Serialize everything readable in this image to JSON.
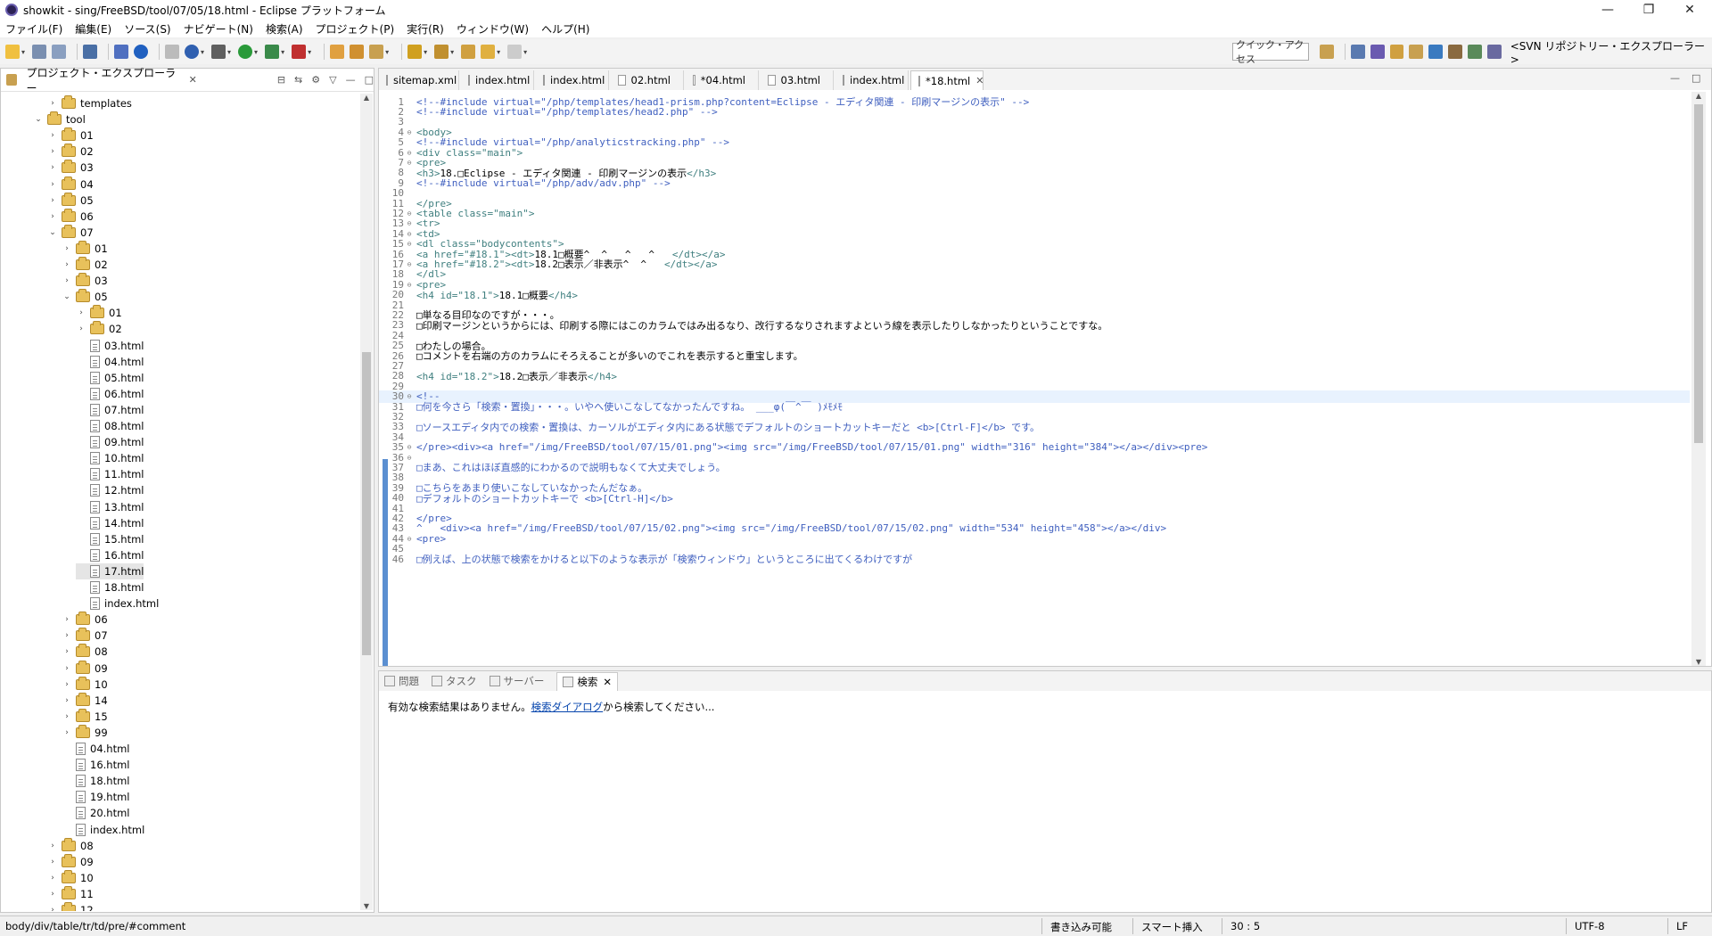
{
  "window": {
    "title": "showkit - sing/FreeBSD/tool/07/05/18.html - Eclipse プラットフォーム",
    "minimize": "—",
    "maximize": "❐",
    "close": "✕"
  },
  "menu": [
    "ファイル(F)",
    "編集(E)",
    "ソース(S)",
    "ナビゲート(N)",
    "検索(A)",
    "プロジェクト(P)",
    "実行(R)",
    "ウィンドウ(W)",
    "ヘルプ(H)"
  ],
  "toolbar": {
    "quick_access": "クイック・アクセス",
    "perspective": "<SVN リポジトリー・エクスプローラー>"
  },
  "explorer": {
    "title": "プロジェクト・エクスプローラー",
    "close": "✕",
    "tree": [
      {
        "label": "templates",
        "type": "folder",
        "level": 2,
        "twisty": "›"
      },
      {
        "label": "tool",
        "type": "project",
        "level": 1,
        "twisty": "⌄"
      },
      {
        "label": "01",
        "type": "folder",
        "level": 2,
        "twisty": "›"
      },
      {
        "label": "02",
        "type": "folder",
        "level": 2,
        "twisty": "›"
      },
      {
        "label": "03",
        "type": "folder",
        "level": 2,
        "twisty": "›"
      },
      {
        "label": "04",
        "type": "folder",
        "level": 2,
        "twisty": "›"
      },
      {
        "label": "05",
        "type": "folder",
        "level": 2,
        "twisty": "›"
      },
      {
        "label": "06",
        "type": "folder",
        "level": 2,
        "twisty": "›"
      },
      {
        "label": "07",
        "type": "folder",
        "level": 2,
        "twisty": "⌄"
      },
      {
        "label": "01",
        "type": "folder",
        "level": 3,
        "twisty": "›"
      },
      {
        "label": "02",
        "type": "folder",
        "level": 3,
        "twisty": "›"
      },
      {
        "label": "03",
        "type": "folder",
        "level": 3,
        "twisty": "›"
      },
      {
        "label": "05",
        "type": "folder",
        "level": 3,
        "twisty": "⌄"
      },
      {
        "label": "01",
        "type": "folder",
        "level": 4,
        "twisty": "›"
      },
      {
        "label": "02",
        "type": "folder",
        "level": 4,
        "twisty": "›"
      },
      {
        "label": "03.html",
        "type": "file",
        "level": 4
      },
      {
        "label": "04.html",
        "type": "file",
        "level": 4
      },
      {
        "label": "05.html",
        "type": "file",
        "level": 4
      },
      {
        "label": "06.html",
        "type": "file",
        "level": 4
      },
      {
        "label": "07.html",
        "type": "file",
        "level": 4
      },
      {
        "label": "08.html",
        "type": "file",
        "level": 4
      },
      {
        "label": "09.html",
        "type": "file",
        "level": 4
      },
      {
        "label": "10.html",
        "type": "file",
        "level": 4
      },
      {
        "label": "11.html",
        "type": "file",
        "level": 4
      },
      {
        "label": "12.html",
        "type": "file",
        "level": 4
      },
      {
        "label": "13.html",
        "type": "file",
        "level": 4
      },
      {
        "label": "14.html",
        "type": "file",
        "level": 4
      },
      {
        "label": "15.html",
        "type": "file",
        "level": 4
      },
      {
        "label": "16.html",
        "type": "file",
        "level": 4
      },
      {
        "label": "17.html",
        "type": "file",
        "level": 4,
        "selected": true
      },
      {
        "label": "18.html",
        "type": "file",
        "level": 4
      },
      {
        "label": "index.html",
        "type": "file",
        "level": 4
      },
      {
        "label": "06",
        "type": "folder",
        "level": 3,
        "twisty": "›"
      },
      {
        "label": "07",
        "type": "folder",
        "level": 3,
        "twisty": "›"
      },
      {
        "label": "08",
        "type": "folder",
        "level": 3,
        "twisty": "›"
      },
      {
        "label": "09",
        "type": "folder",
        "level": 3,
        "twisty": "›"
      },
      {
        "label": "10",
        "type": "folder",
        "level": 3,
        "twisty": "›"
      },
      {
        "label": "14",
        "type": "folder",
        "level": 3,
        "twisty": "›"
      },
      {
        "label": "15",
        "type": "folder",
        "level": 3,
        "twisty": "›"
      },
      {
        "label": "99",
        "type": "folder",
        "level": 3,
        "twisty": "›"
      },
      {
        "label": "04.html",
        "type": "file",
        "level": 3
      },
      {
        "label": "16.html",
        "type": "file",
        "level": 3
      },
      {
        "label": "18.html",
        "type": "file",
        "level": 3
      },
      {
        "label": "19.html",
        "type": "file",
        "level": 3
      },
      {
        "label": "20.html",
        "type": "file",
        "level": 3
      },
      {
        "label": "index.html",
        "type": "file",
        "level": 3
      },
      {
        "label": "08",
        "type": "folder",
        "level": 2,
        "twisty": "›"
      },
      {
        "label": "09",
        "type": "folder",
        "level": 2,
        "twisty": "›"
      },
      {
        "label": "10",
        "type": "folder",
        "level": 2,
        "twisty": "›"
      },
      {
        "label": "11",
        "type": "folder",
        "level": 2,
        "twisty": "›"
      },
      {
        "label": "12",
        "type": "folder",
        "level": 2,
        "twisty": "›"
      }
    ]
  },
  "editor": {
    "tabs": [
      {
        "label": "sitemap.xml",
        "active": false
      },
      {
        "label": "index.html",
        "active": false
      },
      {
        "label": "index.html",
        "active": false
      },
      {
        "label": "02.html",
        "active": false
      },
      {
        "label": "*04.html",
        "active": false
      },
      {
        "label": "03.html",
        "active": false
      },
      {
        "label": "index.html",
        "active": false
      },
      {
        "label": "*18.html",
        "active": true
      }
    ],
    "lines": [
      {
        "n": "1",
        "f": "",
        "segs": [
          [
            "cm",
            "<!--#include virtual=\"/php/templates/head1-prism.php?content=Eclipse - エディタ関連 - 印刷マージンの表示\" -->"
          ]
        ]
      },
      {
        "n": "2",
        "f": "",
        "segs": [
          [
            "cm",
            "<!--#include virtual=\"/php/templates/head2.php\" -->"
          ]
        ]
      },
      {
        "n": "3",
        "f": "",
        "segs": []
      },
      {
        "n": "4",
        "f": "⊖",
        "segs": [
          [
            "tg",
            "<body>"
          ]
        ]
      },
      {
        "n": "5",
        "f": "",
        "segs": [
          [
            "cm",
            "<!--#include virtual=\"/php/analyticstracking.php\" -->"
          ]
        ]
      },
      {
        "n": "6",
        "f": "⊖",
        "segs": [
          [
            "tg",
            "<div class=\"main\">"
          ]
        ]
      },
      {
        "n": "7",
        "f": "⊖",
        "segs": [
          [
            "tg",
            "<pre>"
          ]
        ]
      },
      {
        "n": "8",
        "f": "",
        "segs": [
          [
            "tg",
            "<h3>"
          ],
          [
            "tx",
            "18.□Eclipse - エディタ関連 - 印刷マージンの表示"
          ],
          [
            "tg",
            "</h3>"
          ]
        ]
      },
      {
        "n": "9",
        "f": "",
        "segs": [
          [
            "cm",
            "<!--#include virtual=\"/php/adv/adv.php\" -->"
          ]
        ]
      },
      {
        "n": "10",
        "f": "",
        "segs": []
      },
      {
        "n": "11",
        "f": "",
        "segs": [
          [
            "tg",
            "</pre>"
          ]
        ]
      },
      {
        "n": "12",
        "f": "⊖",
        "segs": [
          [
            "tg",
            "<table class=\"main\">"
          ]
        ]
      },
      {
        "n": "13",
        "f": "⊖",
        "segs": [
          [
            "tg",
            "<tr>"
          ]
        ]
      },
      {
        "n": "14",
        "f": "⊖",
        "segs": [
          [
            "tg",
            "<td>"
          ]
        ]
      },
      {
        "n": "15",
        "f": "⊖",
        "segs": [
          [
            "tg",
            "<dl class=\"bodycontents\">"
          ]
        ]
      },
      {
        "n": "16",
        "f": "",
        "segs": [
          [
            "tg",
            "<a href=\"#18.1\"><dt>"
          ],
          [
            "tx",
            "18.1□概要^  ^   ^   ^   "
          ],
          [
            "tg",
            "</dt></a>"
          ]
        ]
      },
      {
        "n": "17",
        "f": "⊖",
        "segs": [
          [
            "tg",
            "<a href=\"#18.2\"><dt>"
          ],
          [
            "tx",
            "18.2□表示／非表示^  ^   "
          ],
          [
            "tg",
            "</dt></a>"
          ]
        ]
      },
      {
        "n": "18",
        "f": "",
        "segs": [
          [
            "tg",
            "</dl>"
          ]
        ]
      },
      {
        "n": "19",
        "f": "⊖",
        "segs": [
          [
            "tg",
            "<pre>"
          ]
        ]
      },
      {
        "n": "20",
        "f": "",
        "segs": [
          [
            "tg",
            "<h4 id=\"18.1\">"
          ],
          [
            "tx",
            "18.1□概要"
          ],
          [
            "tg",
            "</h4>"
          ]
        ]
      },
      {
        "n": "21",
        "f": "",
        "segs": []
      },
      {
        "n": "22",
        "f": "",
        "segs": [
          [
            "tx",
            "□単なる目印なのですが・・・。"
          ]
        ]
      },
      {
        "n": "23",
        "f": "",
        "segs": [
          [
            "tx",
            "□印刷マージンというからには、印刷する際にはこのカラムではみ出るなり、改行するなりされますよという線を表示したりしなかったりということですな。"
          ]
        ]
      },
      {
        "n": "24",
        "f": "",
        "segs": []
      },
      {
        "n": "25",
        "f": "",
        "segs": [
          [
            "tx",
            "□わたしの場合。"
          ]
        ]
      },
      {
        "n": "26",
        "f": "",
        "segs": [
          [
            "tx",
            "□コメントを右端の方のカラムにそろえることが多いのでこれを表示すると重宝します。"
          ]
        ]
      },
      {
        "n": "27",
        "f": "",
        "segs": []
      },
      {
        "n": "28",
        "f": "",
        "segs": [
          [
            "tg",
            "<h4 id=\"18.2\">"
          ],
          [
            "tx",
            "18.2□表示／非表示"
          ],
          [
            "tg",
            "</h4>"
          ]
        ]
      },
      {
        "n": "29",
        "f": "",
        "segs": []
      },
      {
        "n": "30",
        "f": "⊖",
        "cur": true,
        "segs": [
          [
            "cm",
            "<!--"
          ]
        ]
      },
      {
        "n": "31",
        "f": "",
        "segs": [
          [
            "cm",
            "□何を今さら「検索・置換」・・・。いやへ使いこなしてなかったんですね。 ___φ(￣^￣ )ﾒﾓﾒﾓ"
          ]
        ]
      },
      {
        "n": "32",
        "f": "",
        "segs": []
      },
      {
        "n": "33",
        "f": "",
        "segs": [
          [
            "cm",
            "□ソースエディタ内での検索・置換は、カーソルがエディタ内にある状態でデフォルトのショートカットキーだと <b>[Ctrl-F]</b> です。"
          ]
        ]
      },
      {
        "n": "34",
        "f": "",
        "segs": []
      },
      {
        "n": "35",
        "f": "⊖",
        "segs": [
          [
            "cm",
            "</pre><div><a href=\"/img/FreeBSD/tool/07/15/01.png\"><img src=\"/img/FreeBSD/tool/07/15/01.png\" width=\"316\" height=\"384\"></a></div><pre>"
          ]
        ]
      },
      {
        "n": "36",
        "f": "⊖",
        "segs": []
      },
      {
        "n": "37",
        "f": "",
        "segs": [
          [
            "cm",
            "□まあ、これはほぼ直感的にわかるので説明もなくて大丈夫でしょう。"
          ]
        ]
      },
      {
        "n": "38",
        "f": "",
        "segs": []
      },
      {
        "n": "39",
        "f": "",
        "segs": [
          [
            "cm",
            "□こちらをあまり使いこなしていなかったんだなぁ。"
          ]
        ]
      },
      {
        "n": "40",
        "f": "",
        "segs": [
          [
            "cm",
            "□デフォルトのショートカットキーで <b>[Ctrl-H]</b>"
          ]
        ]
      },
      {
        "n": "41",
        "f": "",
        "segs": []
      },
      {
        "n": "42",
        "f": "",
        "segs": [
          [
            "cm",
            "</pre>"
          ]
        ]
      },
      {
        "n": "43",
        "f": "",
        "segs": [
          [
            "cm",
            "^   <div><a href=\"/img/FreeBSD/tool/07/15/02.png\"><img src=\"/img/FreeBSD/tool/07/15/02.png\" width=\"534\" height=\"458\"></a></div>"
          ]
        ]
      },
      {
        "n": "44",
        "f": "⊖",
        "segs": [
          [
            "cm",
            "<pre>"
          ]
        ]
      },
      {
        "n": "45",
        "f": "",
        "segs": []
      },
      {
        "n": "46",
        "f": "",
        "segs": [
          [
            "cm",
            "□例えば、上の状態で検索をかけると以下のような表示が「検索ウィンドウ」というところに出てくるわけですが"
          ]
        ]
      }
    ]
  },
  "bottom": {
    "tabs": [
      {
        "label": "問題",
        "active": false
      },
      {
        "label": "タスク",
        "active": false
      },
      {
        "label": "サーバー",
        "active": false
      },
      {
        "label": "検索",
        "active": true
      }
    ],
    "message_prefix": "有効な検索結果はありません。",
    "message_link": "検索ダイアログ",
    "message_suffix": "から検索してください..."
  },
  "status": {
    "path": "body/div/table/tr/td/pre/#comment",
    "writable": "書き込み可能",
    "insert_mode": "スマート挿入",
    "position": "30 : 5",
    "encoding": "UTF-8",
    "line_ending": "LF"
  }
}
